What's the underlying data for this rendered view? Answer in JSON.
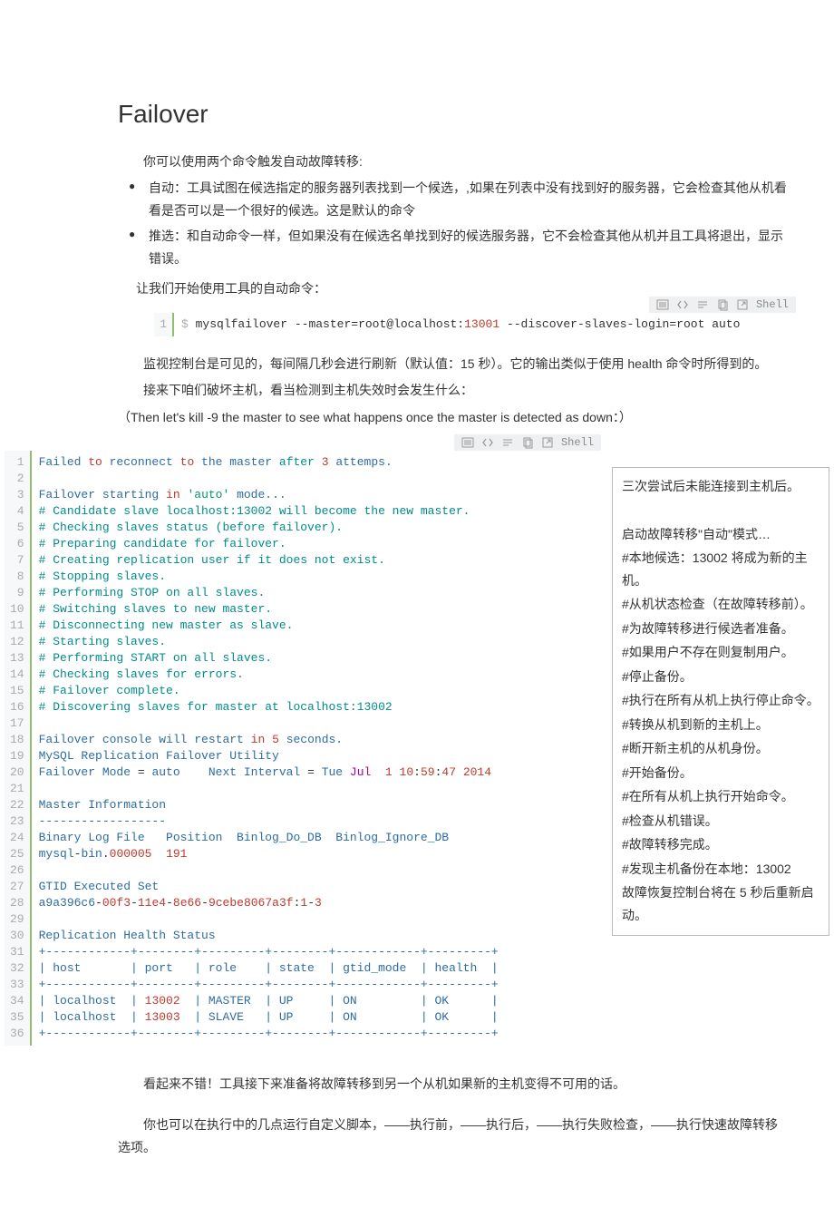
{
  "title": "Failover",
  "intro": "你可以使用两个命令触发自动故障转移:",
  "bullets": [
    "自动：工具试图在候选指定的服务器列表找到一个候选，,如果在列表中没有找到好的服务器，它会检查其他从机看看是否可以是一个很好的候选。这是默认的命令",
    "推选：和自动命令一样，但如果没有在候选名单找到好的候选服务器，它不会检查其他从机并且工具将退出，显示错误。"
  ],
  "intro_tail": "让我们开始使用工具的自动命令：",
  "shell_label": "Shell",
  "cmd1": {
    "plain0": "$",
    "plain1": " mysqlfailover ",
    "plain2": "--master",
    "plain3": "=",
    "plain4": "root@localhost",
    "plain5": ":",
    "num1": "13001",
    "plain6": " --discover-slaves-login",
    "plain7": "=",
    "plain8": "root",
    "plain9": " auto"
  },
  "mid1": "监视控制台是可见的，每间隔几秒会进行刷新（默认值：15 秒）。它的输出类似于使用 health 命令时所得到的。",
  "mid2": "接来下咱们破坏主机，看当检测到主机失效时会发生什么：",
  "mid3": "（Then let's kill -9 the master to see what happens once the master is detected as down：）",
  "anno": {
    "l1": "三次尝试后未能连接到主机后。",
    "l2": "启动故障转移\"自动\"模式…",
    "l3": "#本地候选：13002 将成为新的主机。",
    "l4": "#从机状态检查（在故障转移前）。",
    "l5": "#为故障转移进行候选者准备。",
    "l6": "#如果用户不存在则复制用户。",
    "l7": "#停止备份。",
    "l8": "#执行在所有从机上执行停止命令。",
    "l9": "#转换从机到新的主机上。",
    "l10": "#断开新主机的从机身份。",
    "l11": "#开始备份。",
    "l12": "#在所有从机上执行开始命令。",
    "l13": "#检查从机错误。",
    "l14": "#故障转移完成。",
    "l15": "#发现主机备份在本地：13002",
    "l16": "故障恢复控制台将在 5 秒后重新启动。"
  },
  "footer1": "看起来不错！工具接下来准备将故障转移到另一个从机如果新的主机变得不可用的话。",
  "footer2": "你也可以在执行中的几点运行自定义脚本，——执行前，——执行后，——执行失败检查，——执行快速故障转移选项。",
  "code2": {
    "l1_a": "Failed ",
    "l1_b": "to",
    "l1_c": " reconnect ",
    "l1_d": "to",
    "l1_e": " the master ",
    "l1_f": "after",
    "l1_g": " ",
    "l1_h": "3",
    "l1_i": " attemps.",
    "l3_a": "Failover starting ",
    "l3_b": "in",
    "l3_c": " ",
    "l3_d": "'auto'",
    "l3_e": " mode...",
    "l4": "# Candidate slave localhost:13002 will become the new master.",
    "l5": "# Checking slaves status (before failover).",
    "l6": "# Preparing candidate for failover.",
    "l7": "# Creating replication user if it does not exist.",
    "l8": "# Stopping slaves.",
    "l9": "# Performing STOP on all slaves.",
    "l10": "# Switching slaves to new master.",
    "l11": "# Disconnecting new master as slave.",
    "l12": "# Starting slaves.",
    "l13": "# Performing START on all slaves.",
    "l14": "# Checking slaves for errors.",
    "l15": "# Failover complete.",
    "l16": "# Discovering slaves for master at localhost:13002",
    "l18_a": "Failover console will restart ",
    "l18_b": "in",
    "l18_c": " ",
    "l18_d": "5",
    "l18_e": " seconds.",
    "l19": "MySQL Replication Failover Utility",
    "l20_a": "Failover Mode ",
    "l20_b": "=",
    "l20_c": " auto    Next Interval ",
    "l20_d": "=",
    "l20_e": " Tue ",
    "l20_f": "Jul",
    "l20_g": "  ",
    "l20_h": "1",
    "l20_i": " ",
    "l20_j": "10",
    "l20_k": ":",
    "l20_l": "59",
    "l20_m": ":",
    "l20_n": "47",
    "l20_o": " ",
    "l20_p": "2014",
    "l22": "Master Information",
    "l23": "------------------",
    "l24": "Binary Log File   Position  Binlog_Do_DB  Binlog_Ignore_DB",
    "l25_a": "mysql",
    "l25_b": "-",
    "l25_c": "bin",
    "l25_d": ".",
    "l25_e": "000005",
    "l25_f": "  ",
    "l25_g": "191",
    "l27": "GTID Executed Set",
    "l28_a": "a9a396c6",
    "l28_b": "-",
    "l28_c": "00f3",
    "l28_d": "-",
    "l28_e": "11e4",
    "l28_f": "-",
    "l28_g": "8e66",
    "l28_h": "-",
    "l28_i": "9cebe8067a3f",
    "l28_j": ":",
    "l28_k": "1",
    "l28_l": "-",
    "l28_m": "3",
    "l30": "Replication Health Status",
    "l31": "+------------+--------+---------+--------+------------+---------+",
    "l32": "| host       | port   | role    | state  | gtid_mode  | health  |",
    "l33": "+------------+--------+---------+--------+------------+---------+",
    "l34_a": "| localhost  | ",
    "l34_b": "13002",
    "l34_c": "  | MASTER  | UP     | ON         | OK      |",
    "l35_a": "| localhost  | ",
    "l35_b": "13003",
    "l35_c": "  | SLAVE   | UP     | ON         | OK      |",
    "l36": "+------------+--------+---------+--------+------------+---------+"
  }
}
